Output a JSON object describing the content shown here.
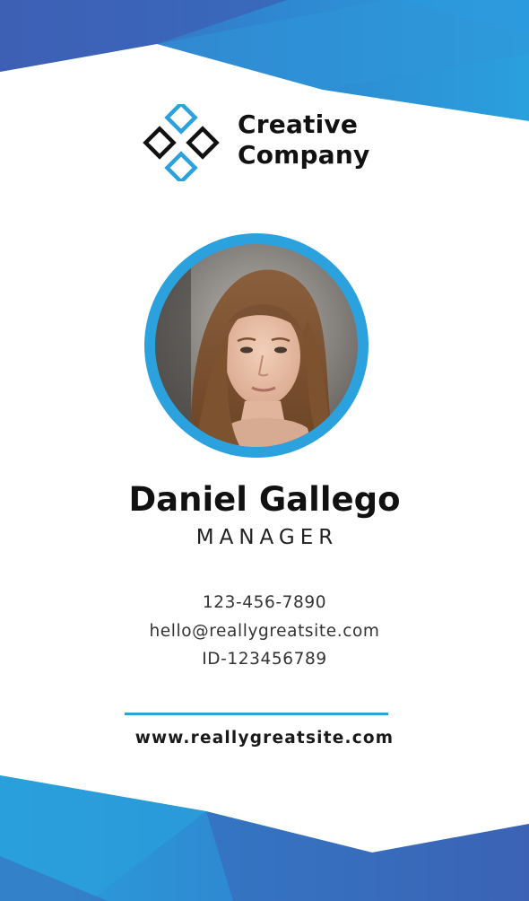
{
  "company": {
    "line1": "Creative",
    "line2": "Company"
  },
  "person": {
    "name": "Daniel Gallego",
    "title": "MANAGER"
  },
  "contact": {
    "phone": "123-456-7890",
    "email": "hello@reallygreatsite.com",
    "id": "ID-123456789"
  },
  "website": "www.reallygreatsite.com",
  "colors": {
    "accent": "#2ba2dd",
    "accent_dark": "#3f63b3",
    "text": "#111111",
    "background": "#ffffff"
  }
}
